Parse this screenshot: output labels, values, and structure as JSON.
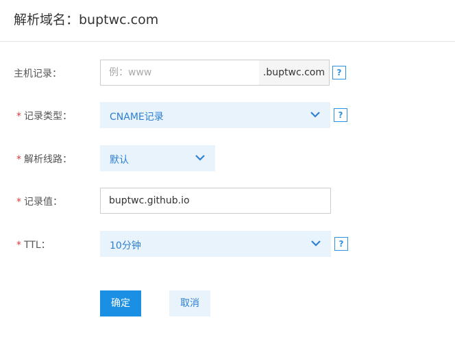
{
  "header": {
    "title": "解析域名：buptwc.com"
  },
  "form": {
    "host": {
      "label": "主机记录：",
      "placeholder": "例：www",
      "value": "",
      "suffix": ".buptwc.com",
      "help": "?"
    },
    "record_type": {
      "required": "*",
      "label": "记录类型：",
      "value": "CNAME记录",
      "help": "?"
    },
    "line": {
      "required": "*",
      "label": "解析线路：",
      "value": "默认"
    },
    "record_value": {
      "required": "*",
      "label": "记录值：",
      "value": "buptwc.github.io"
    },
    "ttl": {
      "required": "*",
      "label": "TTL：",
      "value": "10分钟",
      "help": "?"
    }
  },
  "buttons": {
    "ok": "确定",
    "cancel": "取消"
  },
  "colors": {
    "accent": "#1a8fe3",
    "select_bg": "#e8f3fc",
    "required": "#e4393c"
  },
  "icons": {
    "chevron": "chevron-down-icon",
    "help": "help-icon"
  }
}
